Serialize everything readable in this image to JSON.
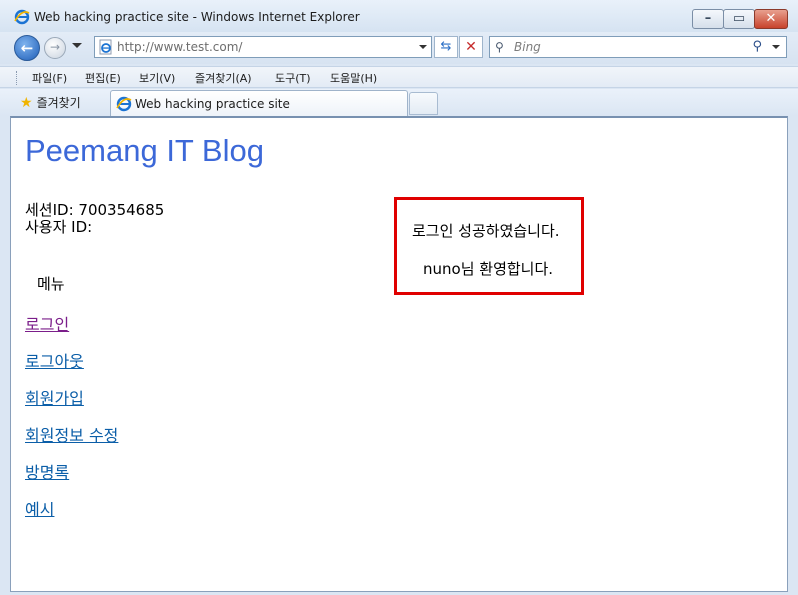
{
  "window": {
    "title": "Web hacking practice site - Windows Internet Explorer"
  },
  "nav": {
    "address": "http://www.test.com/",
    "search_placeholder": "Bing"
  },
  "menubar": {
    "items": [
      "파일(F)",
      "편집(E)",
      "보기(V)",
      "즐겨찾기(A)",
      "도구(T)",
      "도움말(H)"
    ]
  },
  "favorites": {
    "button_label": "즐겨찾기",
    "tab_label": "Web hacking practice site"
  },
  "page": {
    "blog_title": "Peemang IT Blog",
    "session_line": "세션ID: 700354685",
    "user_line": "사용자 ID:",
    "menu_heading": "메뉴",
    "links": [
      "로그인",
      "로그아웃",
      "회원가입",
      "회원정보 수정",
      "방명록",
      "예시"
    ],
    "notice_line1": "로그인 성공하였습니다.",
    "notice_line2": "nuno님 환영합니다."
  },
  "colors": {
    "title_blue": "#3c68d8",
    "link_blue": "#0b5ea8",
    "visited_purple": "#7b1e8a",
    "notice_border": "#e00000"
  }
}
